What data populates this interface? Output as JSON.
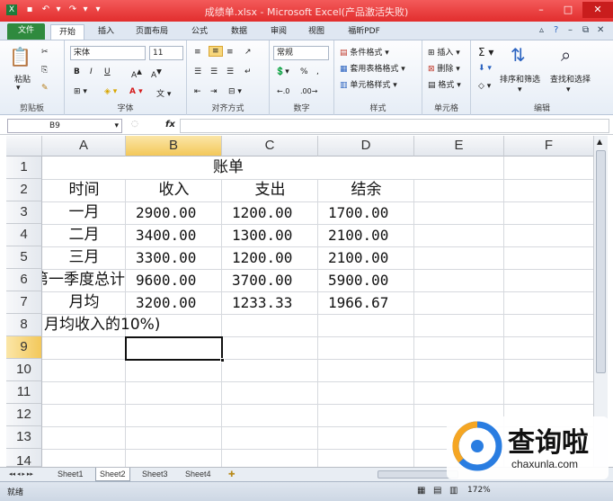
{
  "titlebar": {
    "title": "成绩单.xlsx - Microsoft Excel(产品激活失败)"
  },
  "tabs": [
    "文件",
    "开始",
    "插入",
    "页面布局",
    "公式",
    "数据",
    "审阅",
    "视图",
    "福昕PDF"
  ],
  "ribbon": {
    "clipboard": {
      "paste": "粘贴",
      "label": "剪贴板"
    },
    "font": {
      "name": "宋体",
      "size": "11",
      "label": "字体"
    },
    "alignment": {
      "label": "对齐方式"
    },
    "number": {
      "format": "常规",
      "label": "数字"
    },
    "styles": {
      "conditional": "条件格式",
      "table": "套用表格格式",
      "cell": "单元格样式",
      "label": "样式"
    },
    "cells": {
      "insert": "插入",
      "delete": "删除",
      "format": "格式",
      "label": "单元格"
    },
    "editing": {
      "sort": "排序和筛选",
      "find": "查找和选择",
      "label": "编辑"
    }
  },
  "formula_bar": {
    "name_box": "B9",
    "fx": "fx",
    "value": ""
  },
  "columns": [
    "A",
    "B",
    "C",
    "D",
    "E",
    "F"
  ],
  "rows": [
    "1",
    "2",
    "3",
    "4",
    "5",
    "6",
    "7",
    "8",
    "9",
    "10",
    "11",
    "12",
    "13",
    "14"
  ],
  "cells": {
    "r1": {
      "title": "账单"
    },
    "r2": [
      "时间",
      "收入",
      "支出",
      "结余"
    ],
    "r3": [
      "一月",
      "2900.00",
      "1200.00",
      "1700.00"
    ],
    "r4": [
      "二月",
      "3400.00",
      "1300.00",
      "2100.00"
    ],
    "r5": [
      "三月",
      "3300.00",
      "1200.00",
      "2100.00"
    ],
    "r6": [
      "第一季度总计",
      "9600.00",
      "3700.00",
      "5900.00"
    ],
    "r7": [
      "月均",
      "3200.00",
      "1233.33",
      "1966.67"
    ],
    "r8": "月均收入的10%)"
  },
  "sheets": [
    "Sheet1",
    "Sheet2",
    "Sheet3",
    "Sheet4"
  ],
  "active_sheet": "Sheet2",
  "status": {
    "mode": "就绪",
    "zoom": "172%"
  },
  "watermark": {
    "brand": "查询啦",
    "url": "chaxunla.com"
  },
  "colors": {
    "title": "#e22d2d",
    "file_tab": "#2f8a3e",
    "selection": "#f3c85a"
  }
}
